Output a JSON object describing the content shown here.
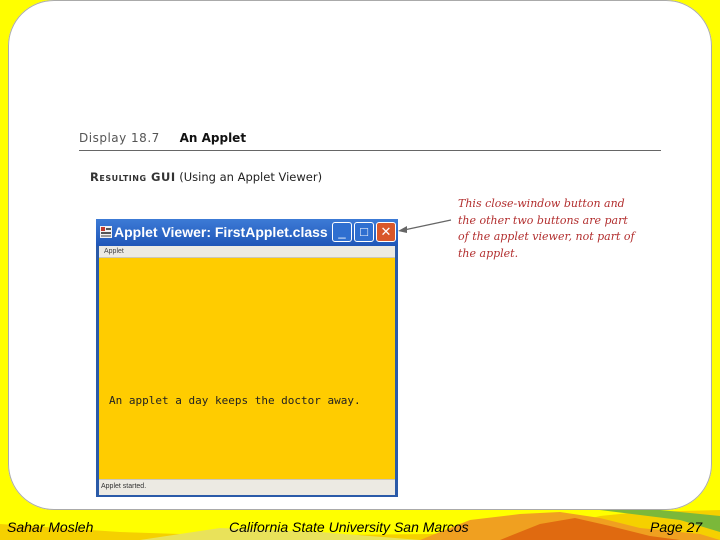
{
  "figure": {
    "display_number": "Display 18.7",
    "display_title": "An Applet",
    "resulting_gui_label": "Resulting GUI",
    "resulting_gui_note": "(Using an Applet Viewer)"
  },
  "applet_window": {
    "title": "Applet Viewer: FirstApplet.class",
    "menu": [
      "Applet"
    ],
    "message": "An applet a day keeps the doctor away.",
    "status": "Applet started.",
    "controls": {
      "minimize": "_",
      "maximize": "□",
      "close": "✕"
    },
    "icons": {
      "app": "applet-viewer-icon",
      "minimize": "minimize-icon",
      "maximize": "maximize-icon",
      "close": "close-icon"
    }
  },
  "annotation": {
    "lines": [
      "This close-window button and",
      "the other two buttons are part",
      "of the applet viewer, not part of",
      "the applet."
    ]
  },
  "footer": {
    "author": "Sahar Mosleh",
    "university": "California State University San Marcos",
    "page": "Page 27"
  },
  "colors": {
    "slide_border": "#ffff00",
    "applet_background": "#ffcc00",
    "titlebar": "#2458b8",
    "annotation_text": "#b22e2e"
  }
}
